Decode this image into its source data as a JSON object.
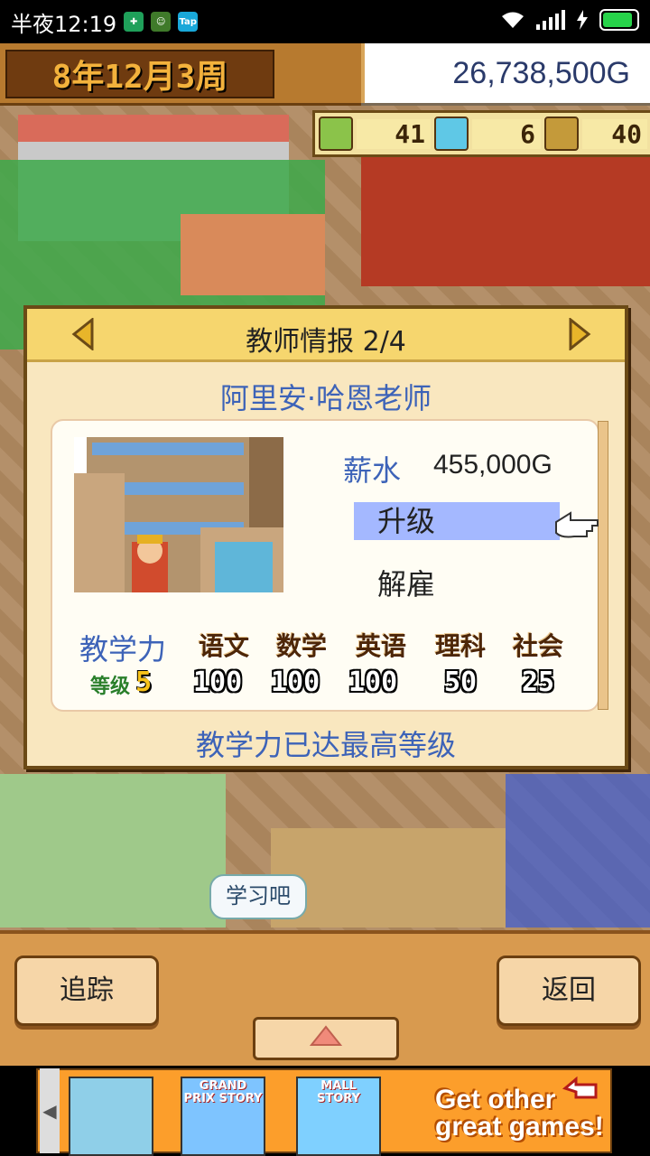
{
  "status_bar": {
    "time": "半夜12:19",
    "app_badge": "Tap"
  },
  "header": {
    "date": "8年12月3周",
    "money": "26,738,500G"
  },
  "stats": {
    "pencil": "41",
    "flask": "6",
    "students": "40"
  },
  "dialog": {
    "title": "教师情报 2/4",
    "teacher_name": "阿里安·哈恩老师",
    "salary_label": "薪水",
    "salary_value": "455,000G",
    "menu_upgrade": "升级",
    "menu_fire": "解雇",
    "teaching_label": "教学力",
    "level_label": "等级",
    "level_value": "5",
    "subjects": [
      {
        "name": "语文",
        "score": "100"
      },
      {
        "name": "数学",
        "score": "100"
      },
      {
        "name": "英语",
        "score": "100"
      },
      {
        "name": "理科",
        "score": "50"
      },
      {
        "name": "社会",
        "score": "25"
      }
    ],
    "max_note": "教学力已达最高等级"
  },
  "scene": {
    "bubble": "学习吧"
  },
  "bottom": {
    "track_label": "追踪",
    "back_label": "返回"
  },
  "ad": {
    "game1": "",
    "game2": "GRAND PRIX STORY",
    "game3": "MALL STORY",
    "cta": "Get other great games!"
  },
  "colors": {
    "accent_blue": "#3d63b8",
    "highlight": "#a4b8ff",
    "panel": "#f9e7bf"
  }
}
